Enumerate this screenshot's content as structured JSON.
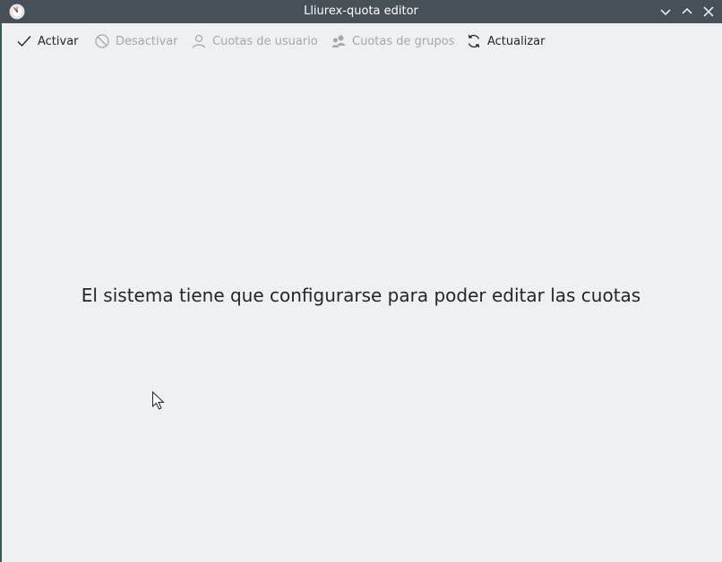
{
  "window": {
    "title": "Lliurex-quota editor",
    "controls": {
      "minimize_icon": "chevron-down-icon",
      "maximize_icon": "chevron-up-icon",
      "close_icon": "close-icon"
    }
  },
  "toolbar": {
    "activate": {
      "label": "Activar",
      "icon": "check-icon",
      "enabled": true
    },
    "deactivate": {
      "label": "Desactivar",
      "icon": "block-icon",
      "enabled": false
    },
    "user_quotas": {
      "label": "Cuotas de usuario",
      "icon": "user-icon",
      "enabled": false
    },
    "group_quotas": {
      "label": "Cuotas de grupos",
      "icon": "group-icon",
      "enabled": false
    },
    "refresh": {
      "label": "Actualizar",
      "icon": "refresh-icon",
      "enabled": true
    }
  },
  "main": {
    "message": "El sistema tiene que configurarse para poder editar las cuotas"
  },
  "colors": {
    "titlebar": "#475057",
    "background": "#eff0f1",
    "text": "#232629",
    "disabled_text": "#a5a7a9"
  }
}
